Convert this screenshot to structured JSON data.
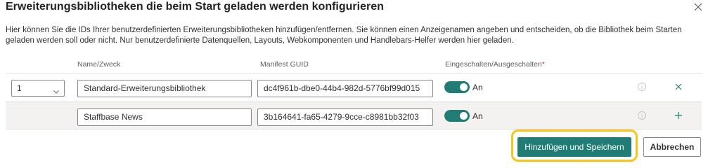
{
  "dialog": {
    "title": "Erweiterungsbibliotheken die beim Start geladen werden konfigurieren",
    "close_icon": "close-icon",
    "description": "Hier können Sie die IDs Ihrer benutzerdefinierten Erweiterungsbibliotheken hinzufügen/entfernen. Sie können einen Anzeigenamen angeben und entscheiden, ob die Bibliothek beim Starten geladen werden soll oder nicht. Nur benutzerdefinierte Datenquellen, Layouts, Webkomponenten und Handlebars-Helfer werden hier geladen."
  },
  "table": {
    "headers": {
      "name": "Name/Zweck",
      "guid": "Manifest GUID",
      "enabled": "Eingeschalten/Ausgeschalten",
      "required_marker": "*"
    },
    "rows": [
      {
        "order": "1",
        "name": "Standard-Erweiterungsbibliothek",
        "guid": "dc4f961b-dbe0-44b4-982d-5776bf99d015",
        "enabled": true,
        "toggle_label": "An",
        "action_icon": "delete-x-icon"
      },
      {
        "order": "",
        "name": "Staffbase News",
        "guid": "3b164641-fa65-4279-9cce-c8981bb32f03",
        "enabled": true,
        "toggle_label": "An",
        "action_icon": "add-plus-icon"
      }
    ]
  },
  "footer": {
    "save_label": "Hinzufügen und Speichern",
    "cancel_label": "Abbrechen"
  },
  "colors": {
    "accent": "#217c76",
    "highlight": "#f5c518",
    "required": "#d13438"
  }
}
